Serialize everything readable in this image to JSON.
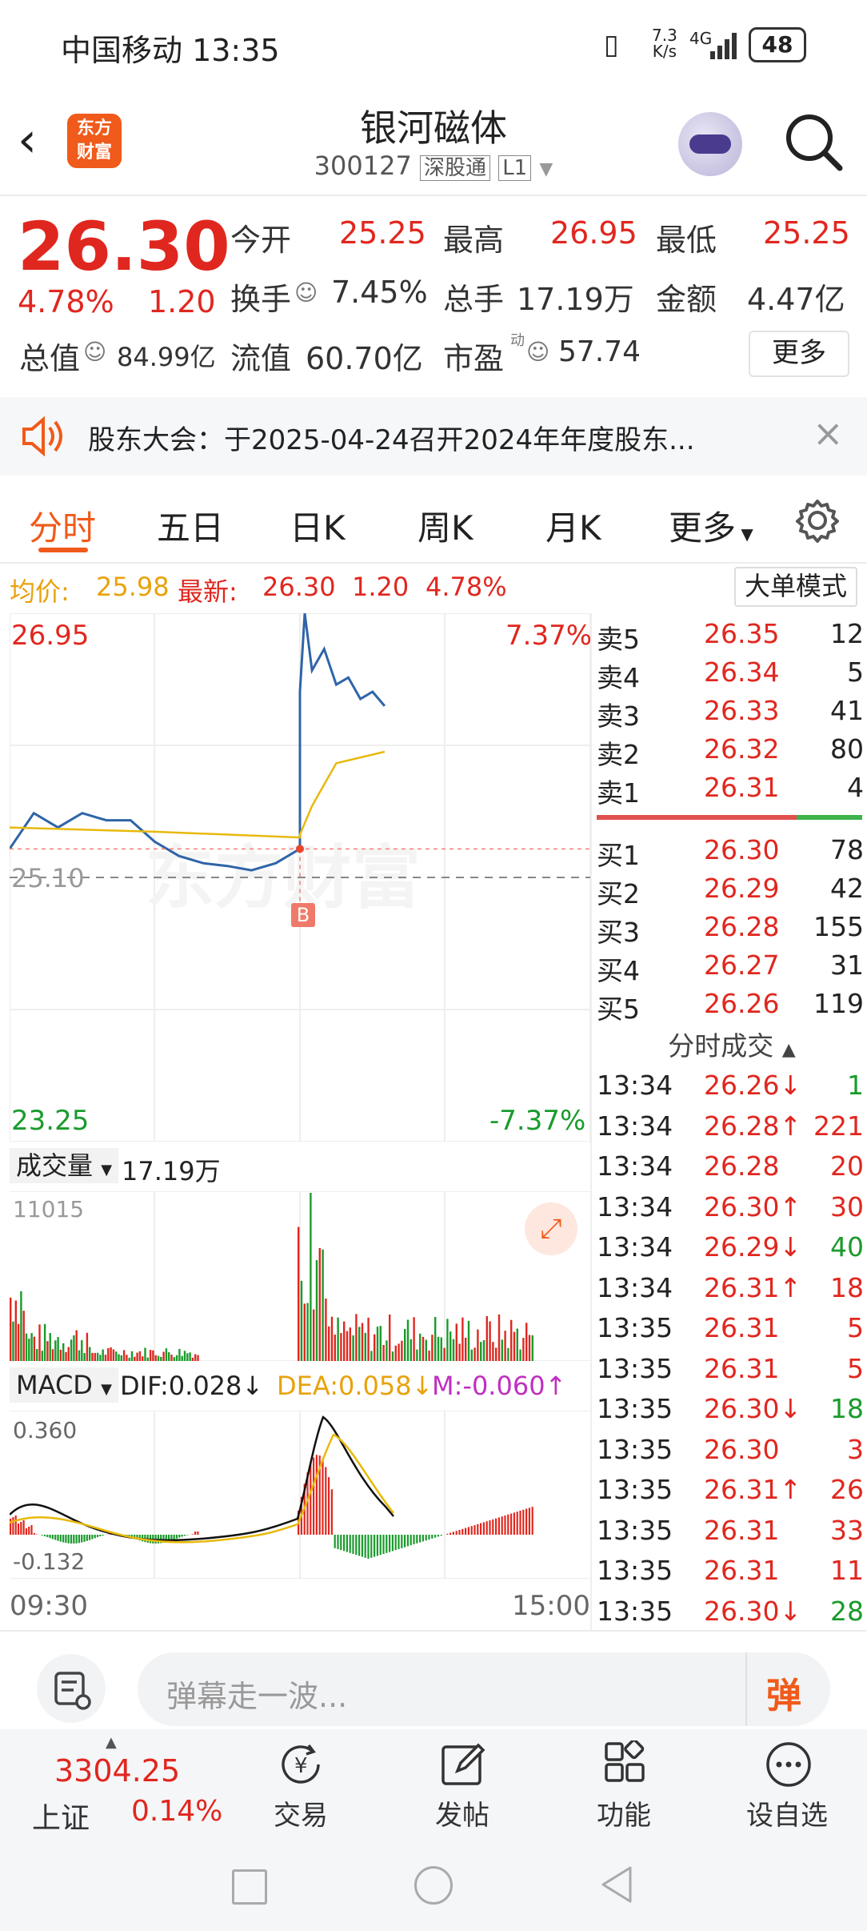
{
  "status": {
    "carrier_time": "中国移动 13:35",
    "net_speed_top": "7.3",
    "net_speed_bottom": "K/s",
    "network": "4G",
    "battery": "48"
  },
  "header": {
    "logo_line1": "东方",
    "logo_line2": "财富",
    "stock_name": "银河磁体",
    "stock_code": "300127",
    "market_badge": "深股通",
    "level_badge": "L1"
  },
  "quote": {
    "price": "26.30",
    "change_pct": "4.78%",
    "change": "1.20",
    "open_label": "今开",
    "open": "25.25",
    "high_label": "最高",
    "high": "26.95",
    "low_label": "最低",
    "low": "25.25",
    "turnover_label": "换手",
    "turnover": "7.45%",
    "volume_label": "总手",
    "volume": "17.19万",
    "amount_label": "金额",
    "amount": "4.47亿",
    "mktcap_label": "总值",
    "mktcap": "84.99亿",
    "float_label": "流值",
    "float": "60.70亿",
    "pe_label": "市盈",
    "pe_sup": "动",
    "pe": "57.74",
    "more_button": "更多"
  },
  "banner": {
    "text": "股东大会：于2025-04-24召开2024年年度股东..."
  },
  "tabs": [
    "分时",
    "五日",
    "日K",
    "周K",
    "月K",
    "更多"
  ],
  "infoline": {
    "avg_label": "均价:",
    "avg": "25.98",
    "last_label": "最新:",
    "last": "26.30",
    "chg": "1.20",
    "pct": "4.78%",
    "big_order_button": "大单模式"
  },
  "chart": {
    "price_high": "26.95",
    "price_low": "23.25",
    "pct_high": "7.37%",
    "pct_low": "-7.37%",
    "prev_close": "25.10",
    "marker": "B",
    "vol_label": "成交量",
    "vol_total": "17.19万",
    "vol_max": "11015",
    "macd_label": "MACD",
    "dif": "DIF:0.028",
    "dea": "DEA:0.058",
    "m": "M:-0.060",
    "macd_max": "0.360",
    "macd_min": "-0.132",
    "time_start": "09:30",
    "time_end": "15:00"
  },
  "chart_data": {
    "type": "line",
    "title": "",
    "x_range": [
      "09:30",
      "15:00"
    ],
    "ylim": [
      23.25,
      26.95
    ],
    "prev_close": 25.1,
    "series": [
      {
        "name": "",
        "x": [
          "09:30",
          "09:40",
          "09:50",
          "10:00",
          "10:10",
          "10:20",
          "10:30",
          "10:40",
          "10:50",
          "11:00",
          "11:10",
          "11:20",
          "11:30",
          "13:00",
          "13:02",
          "13:05",
          "13:10",
          "13:15",
          "13:20",
          "13:25",
          "13:30",
          "13:35"
        ],
        "values": [
          25.3,
          25.55,
          25.45,
          25.55,
          25.5,
          25.5,
          25.35,
          25.25,
          25.2,
          25.18,
          25.15,
          25.2,
          25.3,
          26.4,
          26.95,
          26.55,
          26.7,
          26.45,
          26.5,
          26.35,
          26.4,
          26.3
        ]
      },
      {
        "name": "均价",
        "x": [
          "09:30",
          "10:30",
          "11:30",
          "13:00",
          "13:05",
          "13:15",
          "13:35"
        ],
        "values": [
          25.45,
          25.42,
          25.38,
          25.4,
          25.6,
          25.9,
          25.98
        ]
      }
    ]
  },
  "order_book": {
    "asks": [
      {
        "label": "卖5",
        "price": "26.35",
        "vol": "12"
      },
      {
        "label": "卖4",
        "price": "26.34",
        "vol": "5"
      },
      {
        "label": "卖3",
        "price": "26.33",
        "vol": "41"
      },
      {
        "label": "卖2",
        "price": "26.32",
        "vol": "80"
      },
      {
        "label": "卖1",
        "price": "26.31",
        "vol": "4"
      }
    ],
    "bids": [
      {
        "label": "买1",
        "price": "26.30",
        "vol": "78"
      },
      {
        "label": "买2",
        "price": "26.29",
        "vol": "42"
      },
      {
        "label": "买3",
        "price": "26.28",
        "vol": "155"
      },
      {
        "label": "买4",
        "price": "26.27",
        "vol": "31"
      },
      {
        "label": "买5",
        "price": "26.26",
        "vol": "119"
      }
    ],
    "ticks_title": "分时成交",
    "ticks": [
      {
        "time": "13:34",
        "price": "26.26",
        "dir": "down",
        "vol": "1"
      },
      {
        "time": "13:34",
        "price": "26.28",
        "dir": "up",
        "vol": "221"
      },
      {
        "time": "13:34",
        "price": "26.28",
        "dir": "none",
        "vol": "20"
      },
      {
        "time": "13:34",
        "price": "26.30",
        "dir": "up",
        "vol": "30"
      },
      {
        "time": "13:34",
        "price": "26.29",
        "dir": "down",
        "vol": "40"
      },
      {
        "time": "13:34",
        "price": "26.31",
        "dir": "up",
        "vol": "18"
      },
      {
        "time": "13:35",
        "price": "26.31",
        "dir": "none",
        "vol": "5"
      },
      {
        "time": "13:35",
        "price": "26.31",
        "dir": "none",
        "vol": "5"
      },
      {
        "time": "13:35",
        "price": "26.30",
        "dir": "down",
        "vol": "18"
      },
      {
        "time": "13:35",
        "price": "26.30",
        "dir": "none",
        "vol": "3"
      },
      {
        "time": "13:35",
        "price": "26.31",
        "dir": "up",
        "vol": "26"
      },
      {
        "time": "13:35",
        "price": "26.31",
        "dir": "none",
        "vol": "33"
      },
      {
        "time": "13:35",
        "price": "26.31",
        "dir": "none",
        "vol": "11"
      },
      {
        "time": "13:35",
        "price": "26.30",
        "dir": "down",
        "vol": "28"
      }
    ]
  },
  "comment": {
    "placeholder": "弹幕走一波...",
    "send": "弹"
  },
  "bottom": {
    "index_value": "3304.25",
    "index_name": "上证",
    "index_pct": "0.14%",
    "trade": "交易",
    "post": "发帖",
    "func": "功能",
    "watch": "设自选"
  },
  "colors": {
    "up": "#e0271f",
    "down": "#1a9b2c",
    "avg": "#e8b90c",
    "price_line": "#2f64a8",
    "accent": "#f05a1a"
  }
}
